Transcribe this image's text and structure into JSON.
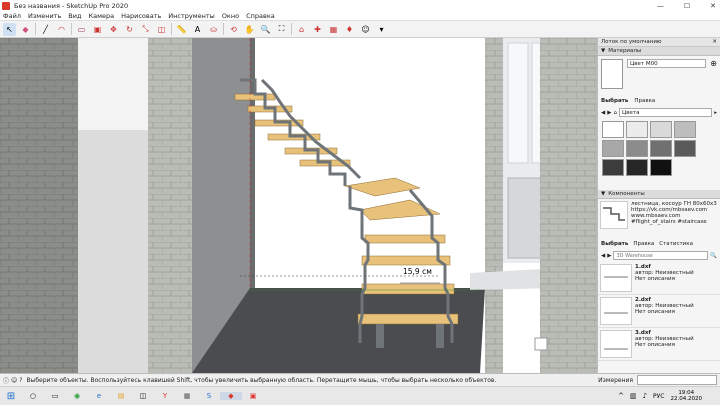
{
  "window": {
    "title": "Без названия - SketchUp Pro 2020",
    "min": "—",
    "max": "☐",
    "close": "✕"
  },
  "menu": [
    "Файл",
    "Изменить",
    "Вид",
    "Камера",
    "Нарисовать",
    "Инструменты",
    "Окно",
    "Справка"
  ],
  "viewport": {
    "dimension_label": "15,9 см"
  },
  "panel": {
    "title": "Лоток по умолчанию",
    "materials": {
      "header": "Материалы",
      "material_name": "Цвет М00",
      "tab_select": "Выбрать",
      "tab_edit": "Правка",
      "category": "Цвета",
      "swatch_colors": [
        "#ffffff",
        "#ececec",
        "#d9d9d9",
        "#bdbdbd",
        "#a8a8a8",
        "#8c8c8c",
        "#707070",
        "#5a5a5a",
        "#3c3c3c",
        "#262626",
        "#111111"
      ]
    },
    "components": {
      "header": "Компоненты",
      "selected_title": "лестница, косоур ГН 80х60х3",
      "selected_desc_1": "https://vk.com/mbsaev.com",
      "selected_desc_2": "www.mbsaev.com",
      "selected_desc_3": "#flight_of_stairs #staircase",
      "tab_select": "Выбрать",
      "tab_edit": "Правка",
      "tab_stats": "Статистика",
      "search_placeholder": "3D Warehouse",
      "items": [
        {
          "name": "1.dxf",
          "author": "автор: Неизвестный",
          "desc": "Нет описания"
        },
        {
          "name": "2.dxf",
          "author": "автор: Неизвестный",
          "desc": "Нет описания"
        },
        {
          "name": "3.dxf",
          "author": "автор: Неизвестный",
          "desc": "Нет описания"
        }
      ]
    }
  },
  "status": {
    "message": "Выберите объекты. Воспользуйтесь клавишей Shift, чтобы увеличить выбранную область. Перетащите мышь, чтобы выбрать несколько объектов.",
    "measure_label": "Измерения"
  },
  "taskbar": {
    "lang": "РУС",
    "time": "19:04",
    "date": "22.04.2020"
  },
  "colors": {
    "accent": "#2b6cb0",
    "tread": "#e8c27a",
    "stringer": "#6f7478",
    "wall": "#bfc3bd",
    "floor": "#4a4c4f"
  }
}
